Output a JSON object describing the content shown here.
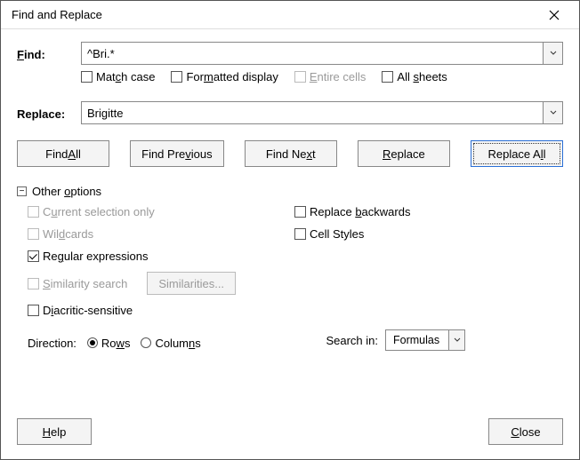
{
  "title": "Find and Replace",
  "find": {
    "label": "Find:",
    "label_u": "F",
    "value": "^Bri.*"
  },
  "find_opts": {
    "match_case": {
      "text": "Match case",
      "u": "c",
      "checked": false,
      "disabled": false
    },
    "formatted": {
      "text": "Formatted display",
      "u": "m",
      "checked": false,
      "disabled": false
    },
    "entire": {
      "text": "Entire cells",
      "u": "E",
      "checked": false,
      "disabled": true
    },
    "all_sheets": {
      "text": "All sheets",
      "u": "s",
      "checked": false,
      "disabled": false
    }
  },
  "replace": {
    "label": "Replace:",
    "value": "Brigitte"
  },
  "buttons": {
    "find_all": {
      "text": "Find All",
      "u": "A"
    },
    "find_prev": {
      "text": "Find Previous",
      "u": "v"
    },
    "find_next": {
      "text": "Find Next",
      "u": "x"
    },
    "replace": {
      "text": "Replace",
      "u": "R"
    },
    "replace_all": {
      "text": "Replace All",
      "u": "l",
      "focused": true
    }
  },
  "other": {
    "head": {
      "text": "Other options",
      "u": "o"
    },
    "current_sel": {
      "text": "Current selection only",
      "u": "u",
      "checked": false,
      "disabled": true
    },
    "wildcards": {
      "text": "Wildcards",
      "u": "d",
      "checked": false,
      "disabled": true
    },
    "regex": {
      "text": "Regular expressions",
      "u": "g",
      "checked": true,
      "disabled": false
    },
    "sim_search": {
      "text": "Similarity search",
      "u": "S",
      "checked": false,
      "disabled": true
    },
    "sim_btn": {
      "text": "Similarities...",
      "disabled": true
    },
    "diacritic": {
      "text": "Diacritic-sensitive",
      "u": "i",
      "checked": false,
      "disabled": false
    },
    "replace_back": {
      "text": "Replace backwards",
      "u": "b",
      "checked": false,
      "disabled": false
    },
    "cell_styles": {
      "text": "Cell Styles",
      "checked": false,
      "disabled": false
    }
  },
  "direction": {
    "label": "Direction:",
    "rows": {
      "text": "Rows",
      "u": "w",
      "selected": true
    },
    "columns": {
      "text": "Columns",
      "u": "n",
      "selected": false
    }
  },
  "searchin": {
    "label": "Search in:",
    "value": "Formulas"
  },
  "footer": {
    "help": {
      "text": "Help",
      "u": "H"
    },
    "close": {
      "text": "Close",
      "u": "C"
    }
  }
}
